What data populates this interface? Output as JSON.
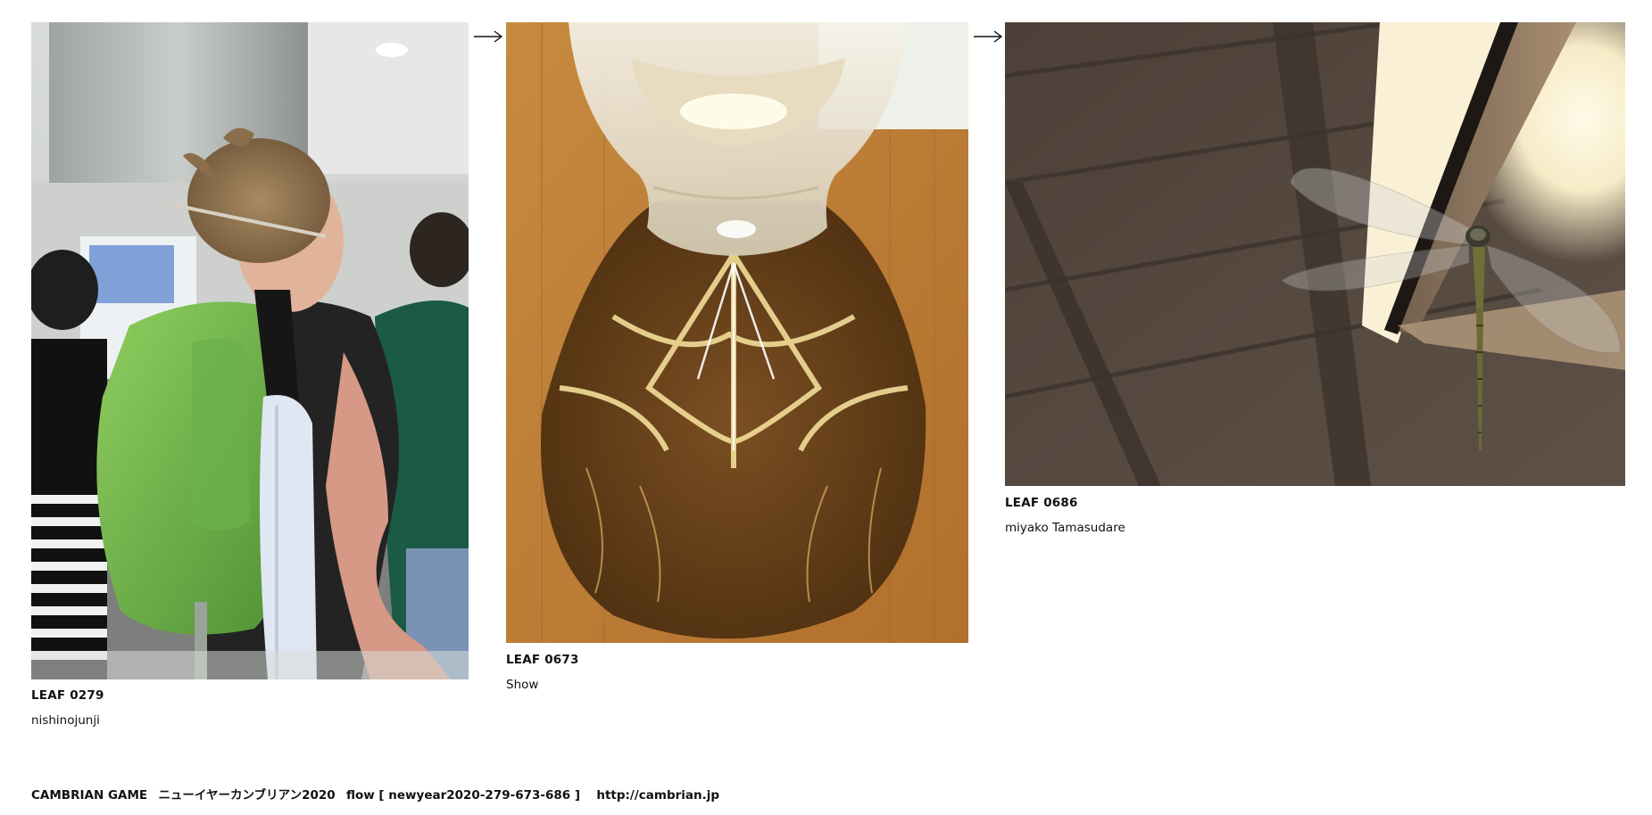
{
  "leaves": [
    {
      "image_name": "leaf-photo-0279",
      "leaf_id": "LEAF 0279",
      "author": "nishinojunji",
      "subject": "backpacker-with-dreadlocks"
    },
    {
      "image_name": "leaf-photo-0673",
      "leaf_id": "LEAF 0673",
      "author": "Show",
      "subject": "glass-caustic-on-wood"
    },
    {
      "image_name": "leaf-photo-0686",
      "leaf_id": "LEAF 0686",
      "author": "miyako Tamasudare",
      "subject": "dragonfly-under-eave"
    }
  ],
  "arrows": [
    "right-arrow-icon",
    "right-arrow-icon"
  ],
  "footer": {
    "title": "CAMBRIAN GAME",
    "event": "ニューイヤーカンブリアン2020",
    "flow": "flow [ newyear2020-279-673-686 ]",
    "url": "http://cambrian.jp"
  },
  "colors": {
    "background": "#ffffff",
    "text": "#111111"
  }
}
